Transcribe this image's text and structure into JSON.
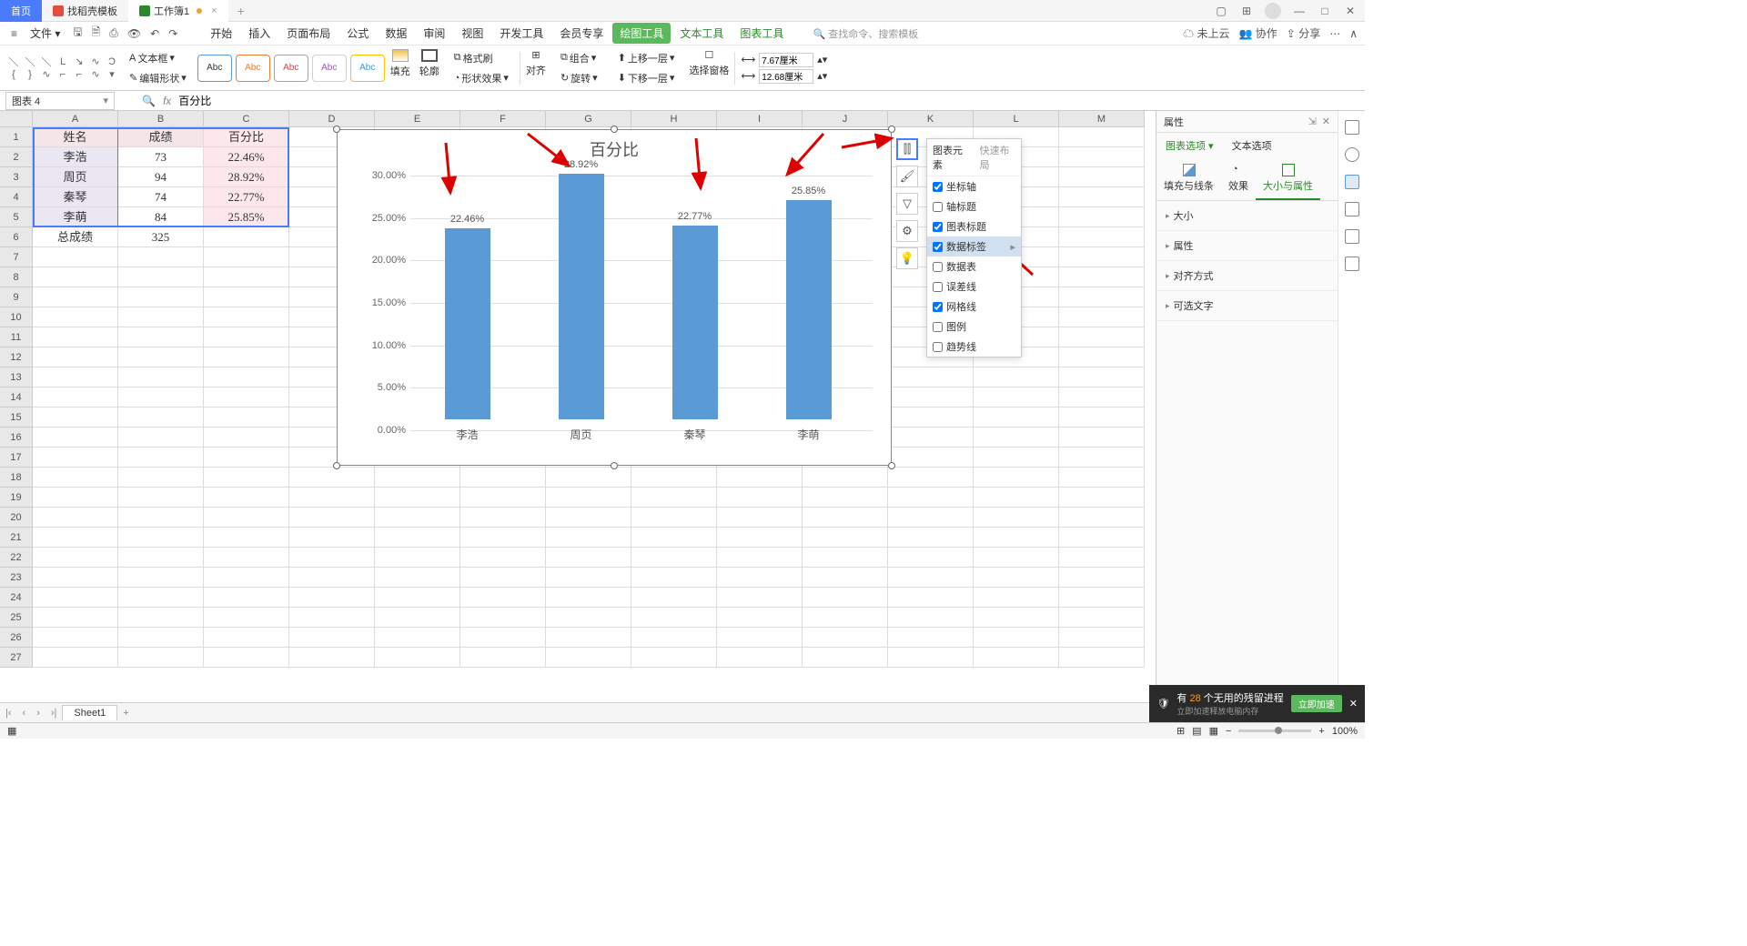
{
  "tabs": {
    "home": "首页",
    "t1": "找稻壳模板",
    "t2": "工作簿1"
  },
  "menu": {
    "file": "文件",
    "items": [
      "开始",
      "插入",
      "页面布局",
      "公式",
      "数据",
      "审阅",
      "视图",
      "开发工具",
      "会员专享"
    ],
    "drawing": "绘图工具",
    "text_tool": "文本工具",
    "chart_tool": "图表工具",
    "search": "查找命令、搜索模板",
    "cloud": "未上云",
    "coop": "协作",
    "share": "分享"
  },
  "ribbon": {
    "textbox": "文本框",
    "edit_shape": "编辑形状",
    "style_label": "Abc",
    "fill": "填充",
    "outline": "轮廓",
    "effect": "形状效果",
    "format_painter": "格式刷",
    "align": "对齐",
    "group": "组合",
    "rotate": "旋转",
    "up_layer": "上移一层",
    "down_layer": "下移一层",
    "select_pane": "选择窗格",
    "height_lbl": "7.67厘米",
    "width_lbl": "12.68厘米"
  },
  "namebox": "图表 4",
  "formula": "百分比",
  "cols": [
    "A",
    "B",
    "C",
    "D",
    "E",
    "F",
    "G",
    "H",
    "I",
    "J",
    "K",
    "L",
    "M"
  ],
  "rows": 27,
  "table": {
    "headers": [
      "姓名",
      "成绩",
      "百分比"
    ],
    "data": [
      [
        "李浩",
        "73",
        "22.46%"
      ],
      [
        "周页",
        "94",
        "28.92%"
      ],
      [
        "秦琴",
        "74",
        "22.77%"
      ],
      [
        "李萌",
        "84",
        "25.85%"
      ]
    ],
    "total": [
      "总成绩",
      "325",
      ""
    ]
  },
  "chart_data": {
    "type": "bar",
    "title": "百分比",
    "categories": [
      "李浩",
      "周页",
      "秦琴",
      "李萌"
    ],
    "values": [
      22.46,
      28.92,
      22.77,
      25.85
    ],
    "value_labels": [
      "22.46%",
      "28.92%",
      "22.77%",
      "25.85%"
    ],
    "ylabel": "",
    "xlabel": "",
    "ylim": [
      0,
      30
    ],
    "yticks": [
      "0.00%",
      "5.00%",
      "10.00%",
      "15.00%",
      "20.00%",
      "25.00%",
      "30.00%"
    ]
  },
  "chart_popup": {
    "tab1": "图表元素",
    "tab2": "快速布局",
    "items": [
      {
        "label": "坐标轴",
        "checked": true
      },
      {
        "label": "轴标题",
        "checked": false
      },
      {
        "label": "图表标题",
        "checked": true
      },
      {
        "label": "数据标签",
        "checked": true,
        "hover": true,
        "arrow": true
      },
      {
        "label": "数据表",
        "checked": false
      },
      {
        "label": "误差线",
        "checked": false
      },
      {
        "label": "网格线",
        "checked": true
      },
      {
        "label": "图例",
        "checked": false
      },
      {
        "label": "趋势线",
        "checked": false
      }
    ]
  },
  "props": {
    "title": "属性",
    "mode1": "图表选项",
    "mode2": "文本选项",
    "tabs": [
      "填充与线条",
      "效果",
      "大小与属性"
    ],
    "sections": [
      "大小",
      "属性",
      "对齐方式",
      "可选文字"
    ]
  },
  "sheet": {
    "name": "Sheet1"
  },
  "status": {
    "zoom": "100%"
  },
  "notif": {
    "text_prefix": "有 ",
    "count": "28",
    "text_suffix": " 个无用的残留进程",
    "sub": "立即加速释放电脑内存",
    "btn": "立即加速"
  }
}
